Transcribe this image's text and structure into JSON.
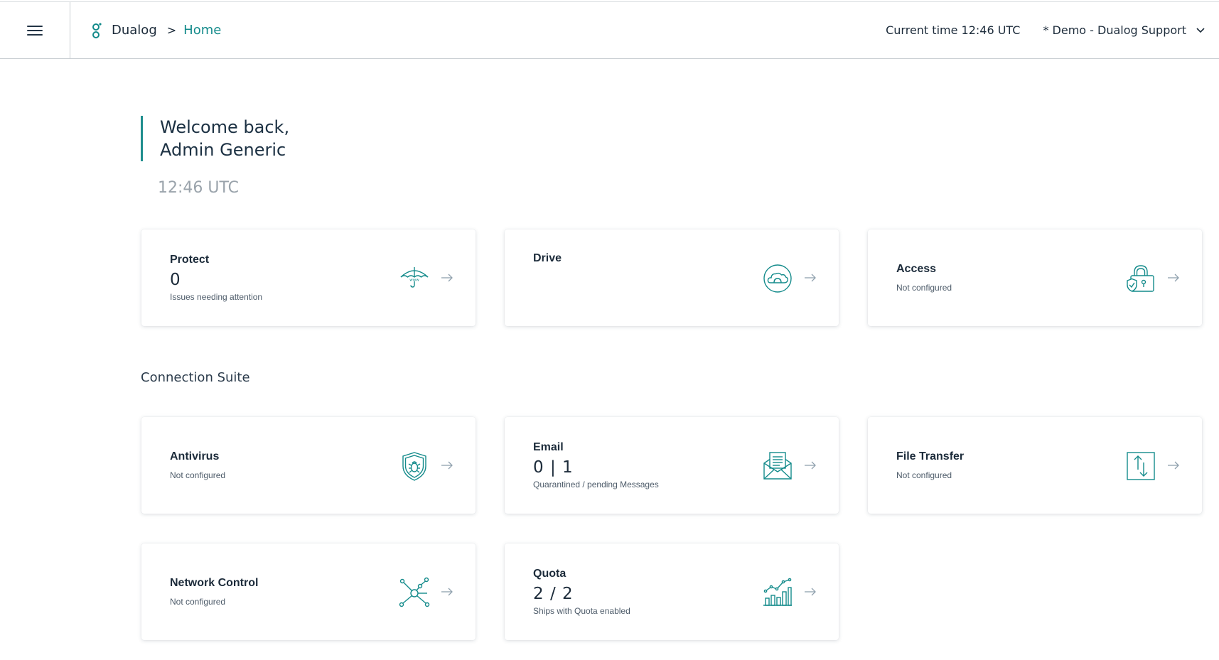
{
  "header": {
    "brand": "Dualog",
    "separator": ">",
    "current_page": "Home",
    "current_time": "Current time 12:46 UTC",
    "account": "* Demo - Dualog Support"
  },
  "welcome": {
    "line1": "Welcome back,",
    "line2": "Admin Generic",
    "clock": "12:46 UTC"
  },
  "top_cards": [
    {
      "title": "Protect",
      "value": "0",
      "sub": "Issues needing attention",
      "icon": "umbrella-www-icon"
    },
    {
      "title": "Drive",
      "icon": "cloud-icon"
    },
    {
      "title": "Access",
      "sub": "Not configured",
      "icon": "lock-shield-icon"
    }
  ],
  "section": {
    "title": "Connection Suite"
  },
  "suite_cards": [
    {
      "title": "Antivirus",
      "sub": "Not configured",
      "icon": "shield-bug-icon"
    },
    {
      "title": "Email",
      "value": "0 | 1",
      "sub": "Quarantined / pending Messages",
      "icon": "envelope-icon"
    },
    {
      "title": "File Transfer",
      "sub": "Not configured",
      "icon": "upload-download-icon"
    },
    {
      "title": "Network Control",
      "sub": "Not configured",
      "icon": "network-nodes-icon"
    },
    {
      "title": "Quota",
      "value": "2 / 2",
      "sub": "Ships with Quota enabled",
      "icon": "bar-chart-icon"
    }
  ],
  "colors": {
    "accent": "#148b8b",
    "text": "#1c2b3a",
    "muted": "#9aa3ab",
    "arrow": "#8fa0ad"
  }
}
